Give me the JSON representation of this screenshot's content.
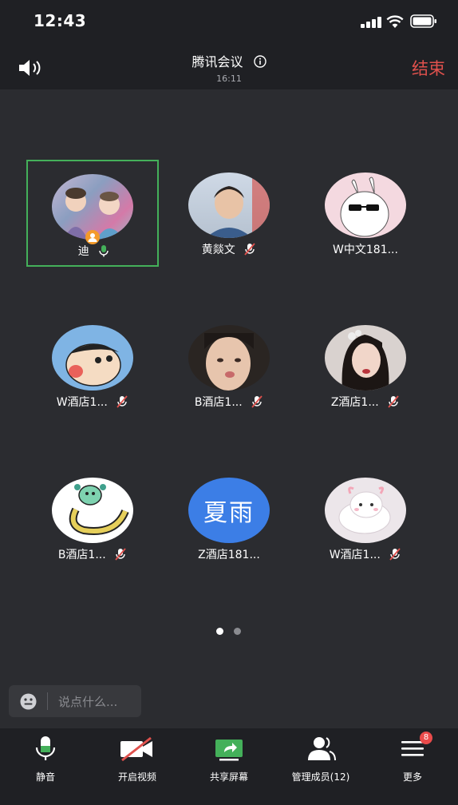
{
  "status_bar": {
    "time": "12:43"
  },
  "header": {
    "title": "腾讯会议",
    "timer": "16:11",
    "end_label": "结束"
  },
  "participants": [
    {
      "name": "迪",
      "mic": "on",
      "host": true,
      "avatar": "photo-two-babies"
    },
    {
      "name": "黄燚文",
      "mic": "muted",
      "avatar": "photo-boy"
    },
    {
      "name": "W中文181...",
      "mic": "none",
      "avatar": "cartoon-bunny-sunglasses"
    },
    {
      "name": "W酒店1...",
      "mic": "muted",
      "avatar": "cartoon-crayon-shinchan"
    },
    {
      "name": "B酒店1...",
      "mic": "muted",
      "avatar": "photo-girl-pout"
    },
    {
      "name": "Z酒店1...",
      "mic": "muted",
      "avatar": "photo-woman"
    },
    {
      "name": "B酒店1...",
      "mic": "muted",
      "avatar": "cartoon-snake"
    },
    {
      "name": "Z酒店181...",
      "mic": "none",
      "avatar": "text",
      "avatar_text": "夏雨",
      "avatar_color": "#3c7ee6"
    },
    {
      "name": "W酒店1...",
      "mic": "muted",
      "avatar": "cartoon-cloud-bunny"
    }
  ],
  "chat": {
    "placeholder": "说点什么..."
  },
  "toolbar": {
    "mute_label": "静音",
    "video_label": "开启视频",
    "share_label": "共享屏幕",
    "members_label": "管理成员(12)",
    "more_label": "更多",
    "more_badge": "8"
  },
  "colors": {
    "active_border": "#44b05a",
    "end_red": "#e0514d",
    "mic_green": "#44b05a",
    "badge_red": "#e94b4b"
  }
}
